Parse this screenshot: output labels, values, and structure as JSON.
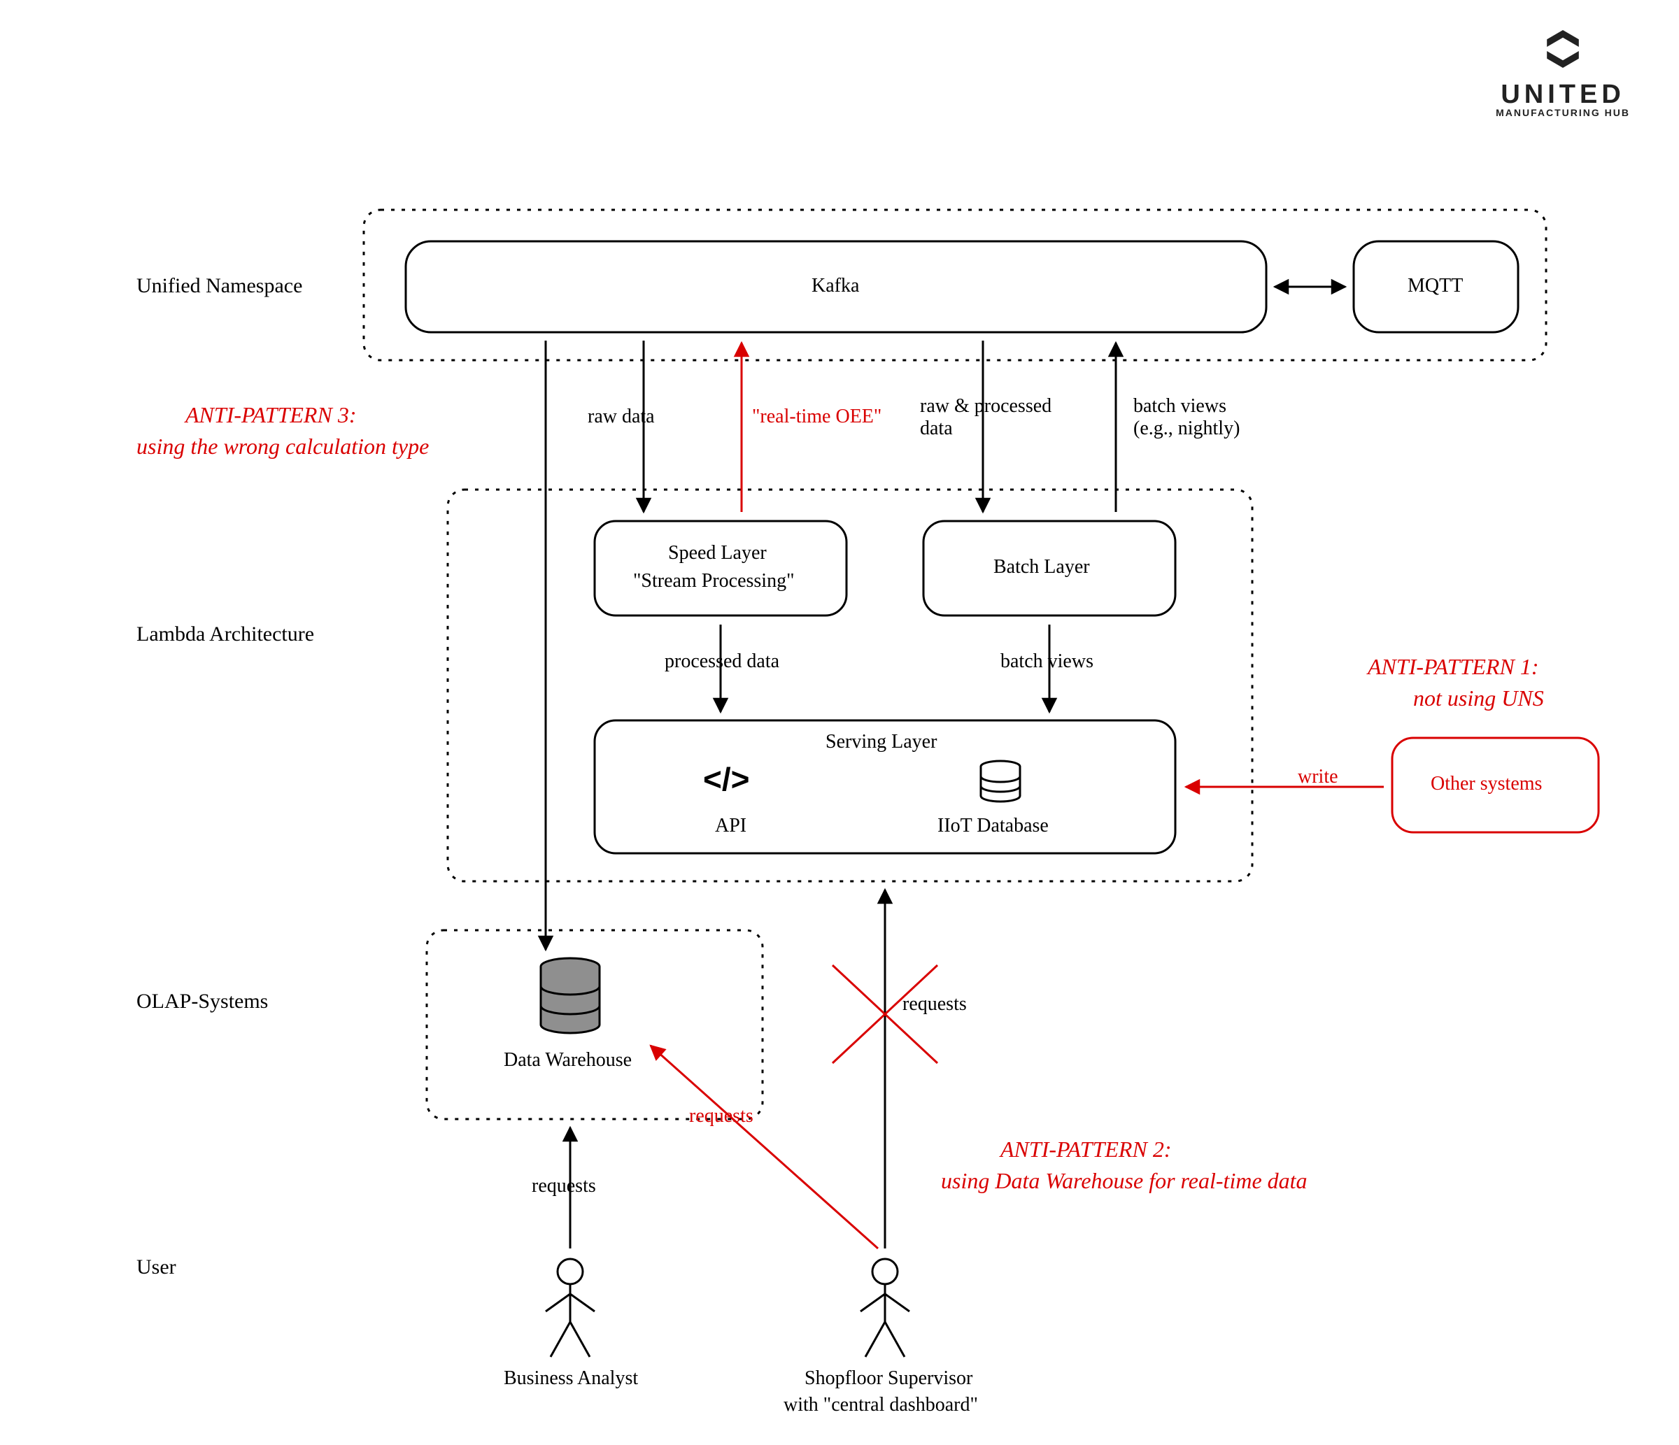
{
  "logo": {
    "title": "UNITED",
    "subtitle": "MANUFACTURING HUB"
  },
  "rows": {
    "unified_namespace": "Unified Namespace",
    "lambda": "Lambda Architecture",
    "olap": "OLAP-Systems",
    "user": "User"
  },
  "boxes": {
    "kafka": "Kafka",
    "mqtt": "MQTT",
    "speed_layer_l1": "Speed Layer",
    "speed_layer_l2": "\"Stream Processing\"",
    "batch_layer": "Batch Layer",
    "serving_layer": "Serving Layer",
    "api": "API",
    "iiot_db": "IIoT Database",
    "data_warehouse": "Data Warehouse",
    "other_systems": "Other systems"
  },
  "edge_labels": {
    "raw_data": "raw data",
    "realtime_oee": "\"real-time OEE\"",
    "raw_processed": "raw & processed\ndata",
    "batch_views_nightly": "batch views\n(e.g., nightly)",
    "processed_data": "processed data",
    "batch_views": "batch views",
    "write": "write",
    "requests": "requests"
  },
  "actors": {
    "business_analyst": "Business Analyst",
    "shopfloor_l1": "Shopfloor Supervisor",
    "shopfloor_l2": "with \"central dashboard\""
  },
  "antipatterns": {
    "ap3_l1": "ANTI-PATTERN 3:",
    "ap3_l2": "using the wrong calculation type",
    "ap1_l1": "ANTI-PATTERN 1:",
    "ap1_l2": "not using UNS",
    "ap2_l1": "ANTI-PATTERN 2:",
    "ap2_l2": "using Data Warehouse for real-time data"
  }
}
